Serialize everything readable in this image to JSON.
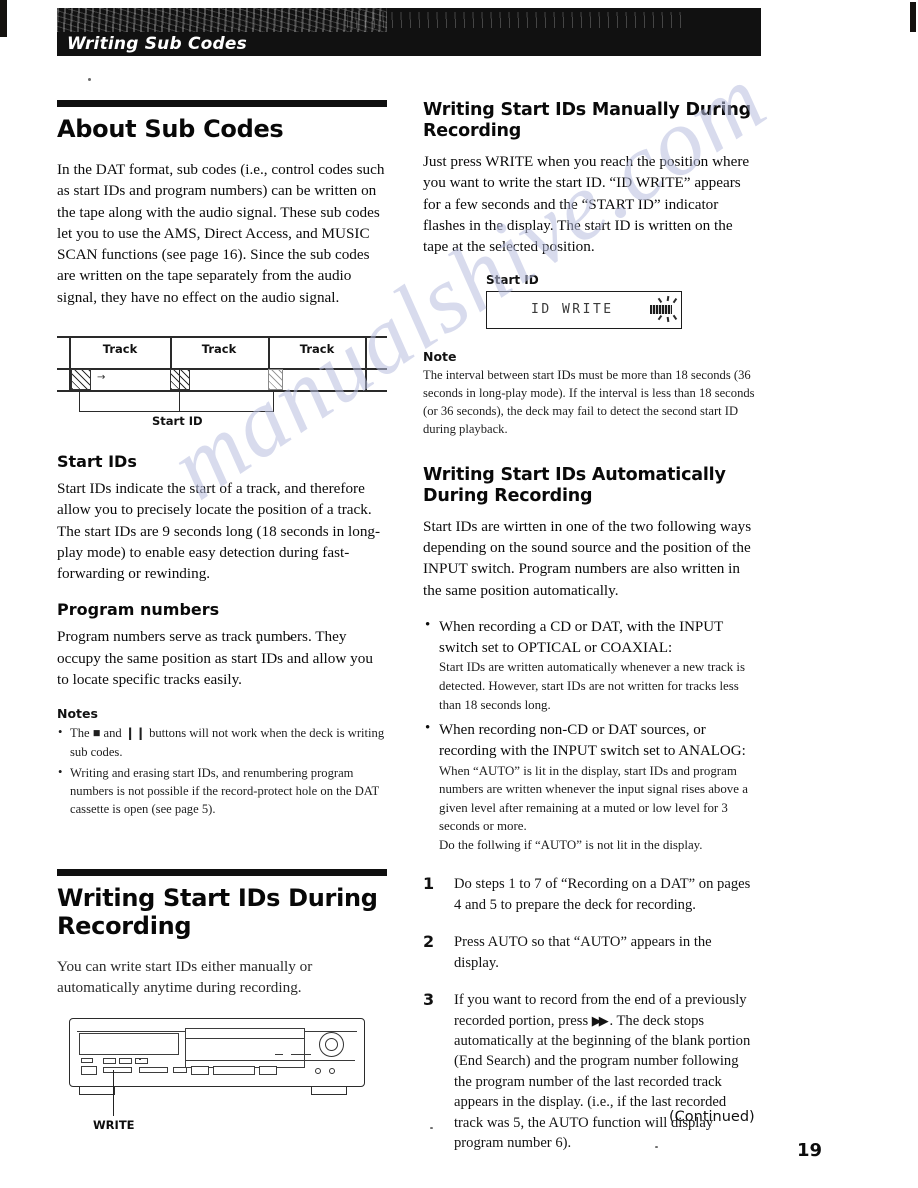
{
  "page": {
    "running_head": "Writing Sub Codes",
    "page_number": "19",
    "continued_label": "(Continued)",
    "watermark": "manualshive.com"
  },
  "left_column": {
    "about": {
      "heading": "About Sub Codes",
      "paragraph": "In the DAT format, sub codes (i.e., control codes such as start IDs and program numbers) can be written on the tape along with the audio signal.  These sub codes let you to use the AMS, Direct Access, and MUSIC SCAN functions (see page 16).  Since the sub codes are written on the tape separately from the audio signal, they have no effect on the audio signal."
    },
    "track_figure": {
      "cells": [
        "Track",
        "Track",
        "Track"
      ],
      "caption": "Start ID"
    },
    "start_ids": {
      "heading": "Start IDs",
      "paragraph": "Start IDs indicate the start of a track, and therefore allow you to precisely locate the position of a track. The start IDs are 9 seconds long (18 seconds in long-play mode) to enable easy detection during fast-forwarding or rewinding."
    },
    "program_numbers": {
      "heading": "Program numbers",
      "paragraph": "Program numbers serve as track numbers.  They occupy the same position as start IDs and allow you to locate specific tracks easily."
    },
    "notes": {
      "heading": "Notes",
      "items": [
        "The ■ and ❙❙ buttons will not work when the deck is writing sub codes.",
        "Writing and erasing start IDs, and renumbering program numbers is not possible if the record-protect hole on the DAT cassette is open (see page 5)."
      ]
    },
    "writing_during_recording": {
      "heading": "Writing Start IDs During Recording",
      "paragraph": "You can write start IDs either manually or automatically anytime during recording.",
      "deck_callout": "WRITE"
    }
  },
  "right_column": {
    "manual": {
      "heading": "Writing Start IDs Manually During Recording",
      "paragraph": "Just press WRITE when you reach the position where you want to write the start ID. “ID WRITE” appears for a few seconds and the “START ID” indicator flashes in the display. The start ID is written on the tape at the selected position.",
      "display_figure": {
        "caption": "Start ID",
        "lcd_text": "ID WRITE"
      },
      "note": {
        "heading": "Note",
        "text": "The interval between start IDs must be more than 18 seconds (36 seconds in long-play mode).  If the interval is less than 18 seconds (or 36 seconds), the deck may fail to detect the second start ID during playback."
      }
    },
    "automatic": {
      "heading": "Writing Start IDs Automatically During Recording",
      "paragraph": "Start IDs are wirtten in one of the two following ways depending on the sound source and the position of the INPUT switch. Program numbers are also written in the same position automatically.",
      "bullets": [
        {
          "lead": "When recording a CD or DAT, with the INPUT switch set to OPTICAL or COAXIAL:",
          "detail": "Start IDs are written automatically whenever a new track is detected. However, start IDs are not written for tracks less than 18 seconds long."
        },
        {
          "lead": "When recording non-CD or DAT sources, or recording with the INPUT switch set to ANALOG:",
          "detail": "When “AUTO” is lit in the display, start IDs and program numbers are written whenever the input signal rises above a given level after remaining at a muted or low level for 3 seconds or more.",
          "detail2": "Do the follwing if “AUTO” is not lit in the display."
        }
      ],
      "steps": [
        {
          "number": "1",
          "text": "Do steps 1 to 7 of “Recording on a DAT” on pages 4 and 5 to prepare the deck for recording."
        },
        {
          "number": "2",
          "text": "Press AUTO so that “AUTO” appears in the display."
        },
        {
          "number": "3",
          "text_before": "If you want to record from the end of a previously recorded portion, press",
          "glyph": "▶▶",
          "text_after": ".",
          "text_rest": "The deck stops automatically at the beginning of the blank portion (End Search) and the program number following the program number of the last recorded track appears in the display. (i.e., if the last recorded track was 5, the AUTO function will display program number 6)."
        }
      ]
    }
  }
}
